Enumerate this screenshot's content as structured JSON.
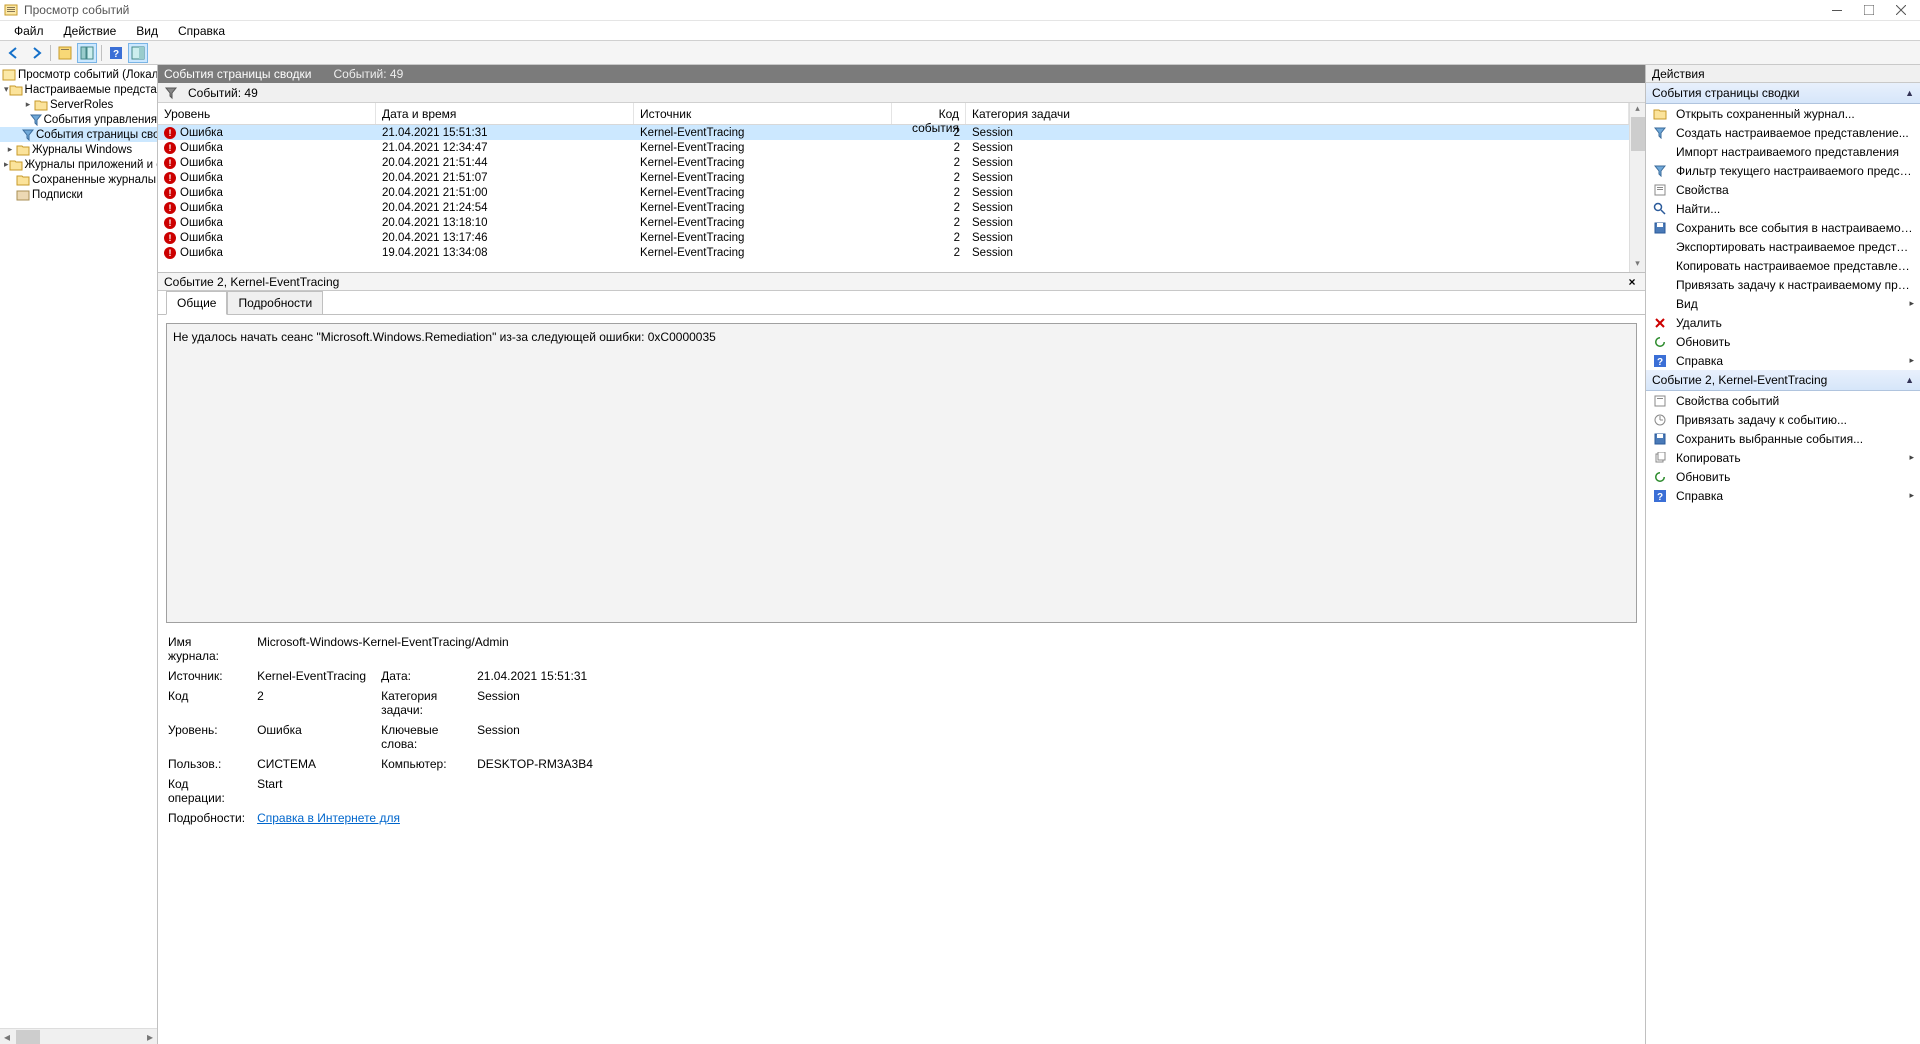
{
  "title": "Просмотр событий",
  "menu": [
    "Файл",
    "Действие",
    "Вид",
    "Справка"
  ],
  "tree": {
    "root": "Просмотр событий (Локальны",
    "customviews": "Настраиваемые представле",
    "serverroles": "ServerRoles",
    "admin_events": "События управления",
    "summary_events": "События страницы сво",
    "winlogs": "Журналы Windows",
    "applogs": "Журналы приложений и сл",
    "savedlogs": "Сохраненные журналы",
    "subs": "Подписки"
  },
  "centerhead": {
    "title": "События страницы сводки",
    "count_label": "Событий: 49"
  },
  "filter": {
    "count_text": "Событий: 49"
  },
  "columns": {
    "level": "Уровень",
    "datetime": "Дата и время",
    "source": "Источник",
    "code": "Код события",
    "task": "Категория задачи"
  },
  "events": [
    {
      "level": "Ошибка",
      "dt": "21.04.2021 15:51:31",
      "src": "Kernel-EventTracing",
      "code": "2",
      "task": "Session"
    },
    {
      "level": "Ошибка",
      "dt": "21.04.2021 12:34:47",
      "src": "Kernel-EventTracing",
      "code": "2",
      "task": "Session"
    },
    {
      "level": "Ошибка",
      "dt": "20.04.2021 21:51:44",
      "src": "Kernel-EventTracing",
      "code": "2",
      "task": "Session"
    },
    {
      "level": "Ошибка",
      "dt": "20.04.2021 21:51:07",
      "src": "Kernel-EventTracing",
      "code": "2",
      "task": "Session"
    },
    {
      "level": "Ошибка",
      "dt": "20.04.2021 21:51:00",
      "src": "Kernel-EventTracing",
      "code": "2",
      "task": "Session"
    },
    {
      "level": "Ошибка",
      "dt": "20.04.2021 21:24:54",
      "src": "Kernel-EventTracing",
      "code": "2",
      "task": "Session"
    },
    {
      "level": "Ошибка",
      "dt": "20.04.2021 13:18:10",
      "src": "Kernel-EventTracing",
      "code": "2",
      "task": "Session"
    },
    {
      "level": "Ошибка",
      "dt": "20.04.2021 13:17:46",
      "src": "Kernel-EventTracing",
      "code": "2",
      "task": "Session"
    },
    {
      "level": "Ошибка",
      "dt": "19.04.2021 13:34:08",
      "src": "Kernel-EventTracing",
      "code": "2",
      "task": "Session"
    }
  ],
  "detail": {
    "header": "Событие 2, Kernel-EventTracing",
    "tab_general": "Общие",
    "tab_details": "Подробности",
    "message": "Не удалось начать сеанс \"Microsoft.Windows.Remediation\" из-за следующей ошибки: 0xC0000035",
    "props": {
      "log_label": "Имя журнала:",
      "log_val": "Microsoft-Windows-Kernel-EventTracing/Admin",
      "src_label": "Источник:",
      "src_val": "Kernel-EventTracing",
      "date_label": "Дата:",
      "date_val": "21.04.2021 15:51:31",
      "code_label": "Код",
      "code_val": "2",
      "taskcat_label": "Категория задачи:",
      "taskcat_val": "Session",
      "level_label": "Уровень:",
      "level_val": "Ошибка",
      "keywords_label": "Ключевые слова:",
      "keywords_val": "Session",
      "user_label": "Пользов.:",
      "user_val": "СИСТЕМА",
      "computer_label": "Компьютер:",
      "computer_val": "DESKTOP-RM3A3B4",
      "opcode_label": "Код операции:",
      "opcode_val": "Start",
      "info_label": "Подробности:",
      "info_link": "Справка в Интернете для"
    }
  },
  "actions": {
    "panel_title": "Действия",
    "group1_title": "События страницы сводки",
    "open_saved": "Открыть сохраненный журнал...",
    "create_custom": "Создать настраиваемое представление...",
    "import_custom": "Импорт настраиваемого представления",
    "filter_current": "Фильтр текущего настраиваемого представлени...",
    "props": "Свойства",
    "find": "Найти...",
    "save_all": "Сохранить все события в настраиваемом представл...",
    "export_custom": "Экспортировать настраиваемое представление...",
    "copy_custom": "Копировать настраиваемое представление...",
    "attach_task": "Привязать задачу к настраиваемому представлени...",
    "view": "Вид",
    "delete": "Удалить",
    "refresh": "Обновить",
    "help": "Справка",
    "group2_title": "Событие 2, Kernel-EventTracing",
    "event_props": "Свойства событий",
    "attach_event_task": "Привязать задачу к событию...",
    "save_selected": "Сохранить выбранные события...",
    "copy": "Копировать",
    "refresh2": "Обновить",
    "help2": "Справка"
  }
}
